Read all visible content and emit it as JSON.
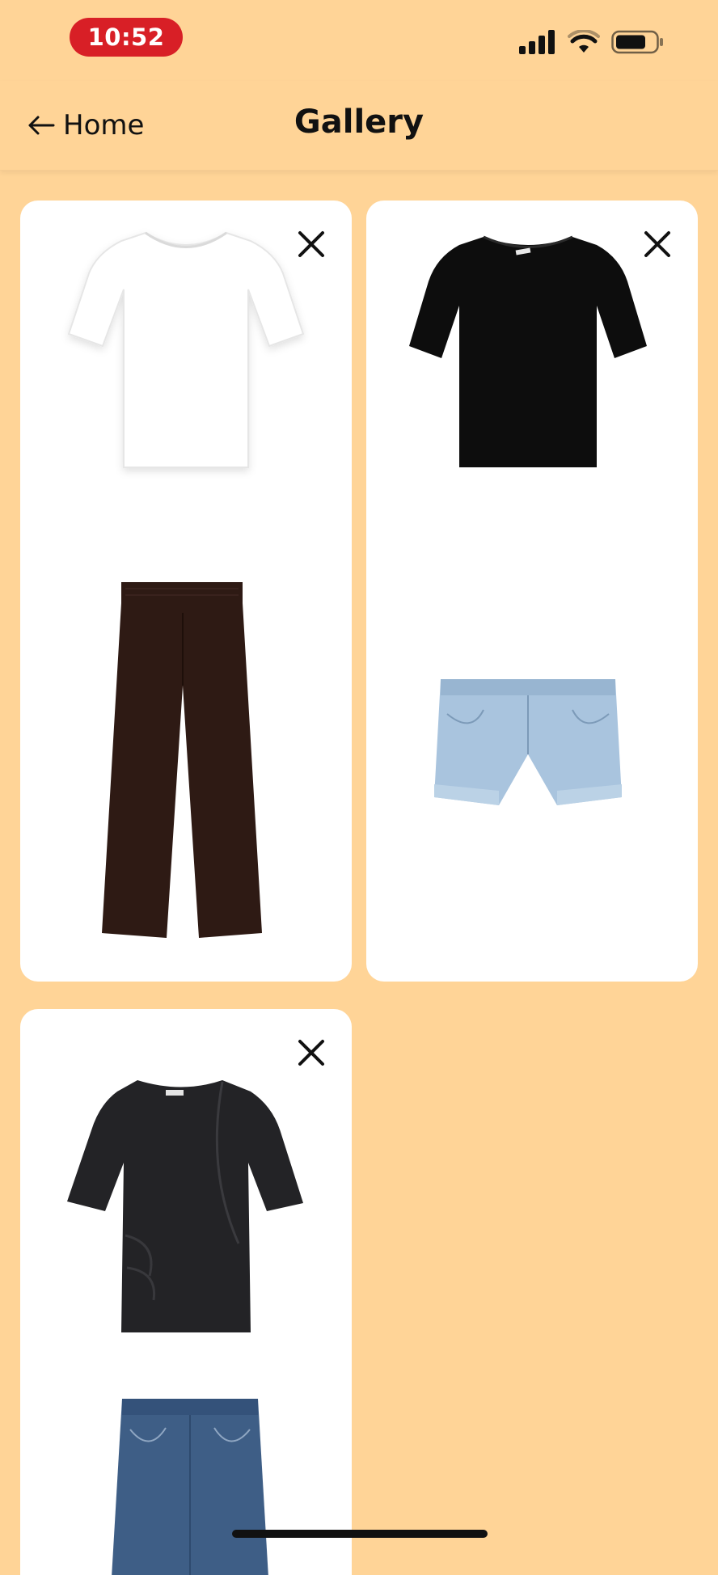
{
  "status_bar": {
    "time": "10:52",
    "time_pill_color": "#D81F26",
    "icons": [
      "signal-icon",
      "wifi-icon",
      "battery-icon"
    ]
  },
  "header": {
    "back_label": "Home",
    "back_icon": "arrow-left-icon",
    "title": "Gallery"
  },
  "colors": {
    "background": "#FFD497",
    "card": "#FFFFFF"
  },
  "gallery": {
    "outfits": [
      {
        "remove_icon": "close-icon",
        "items": [
          {
            "type": "t-shirt",
            "color": "#FFFFFF"
          },
          {
            "type": "wide-leg-trousers",
            "color": "#2E1A14"
          }
        ]
      },
      {
        "remove_icon": "close-icon",
        "items": [
          {
            "type": "t-shirt",
            "color": "#0D0D0D"
          },
          {
            "type": "denim-shorts",
            "color": "#A9C4DE"
          }
        ]
      },
      {
        "remove_icon": "close-icon",
        "items": [
          {
            "type": "draped-t-shirt",
            "color": "#232326"
          },
          {
            "type": "jeans",
            "color": "#3E5E86"
          }
        ]
      }
    ]
  }
}
